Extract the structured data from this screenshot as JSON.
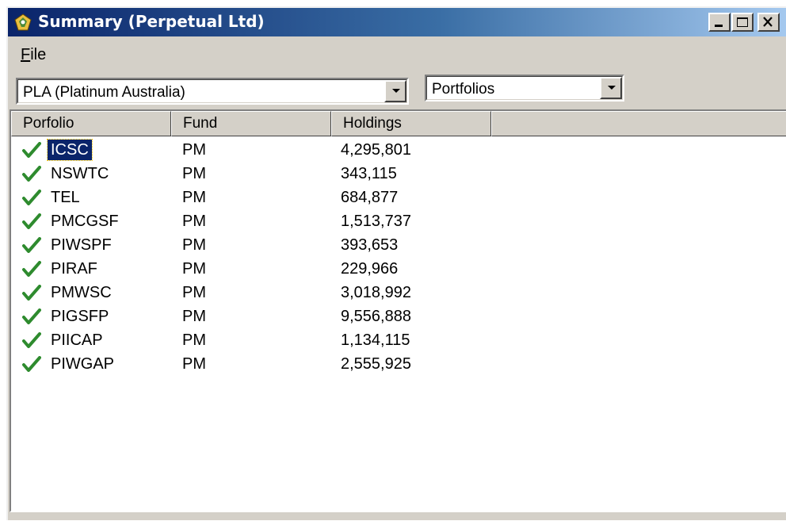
{
  "window": {
    "title": "Summary (Perpetual Ltd)",
    "icon": "app-icon",
    "controls": [
      "minimize-icon",
      "maximize-icon",
      "close-icon"
    ]
  },
  "menu": {
    "file_label_first": "F",
    "file_label_rest": "ile"
  },
  "filters": {
    "company": "PLA (Platinum Australia)",
    "view": "Portfolios"
  },
  "table": {
    "headers": [
      "Porfolio",
      "Fund",
      "Holdings",
      ""
    ],
    "rows": [
      {
        "portfolio": "ICSC",
        "fund": "PM",
        "holdings": "4,295,801",
        "status": "check-icon",
        "selected": true
      },
      {
        "portfolio": "NSWTC",
        "fund": "PM",
        "holdings": "343,115",
        "status": "check-icon"
      },
      {
        "portfolio": "TEL",
        "fund": "PM",
        "holdings": "684,877",
        "status": "check-icon"
      },
      {
        "portfolio": "PMCGSF",
        "fund": "PM",
        "holdings": "1,513,737",
        "status": "check-icon"
      },
      {
        "portfolio": "PIWSPF",
        "fund": "PM",
        "holdings": "393,653",
        "status": "check-icon"
      },
      {
        "portfolio": "PIRAF",
        "fund": "PM",
        "holdings": "229,966",
        "status": "check-icon"
      },
      {
        "portfolio": "PMWSC",
        "fund": "PM",
        "holdings": "3,018,992",
        "status": "check-icon"
      },
      {
        "portfolio": "PIGSFP",
        "fund": "PM",
        "holdings": "9,556,888",
        "status": "check-icon"
      },
      {
        "portfolio": "PIICAP",
        "fund": "PM",
        "holdings": "1,134,115",
        "status": "check-icon"
      },
      {
        "portfolio": "PIWGAP",
        "fund": "PM",
        "holdings": "2,555,925",
        "status": "check-icon"
      }
    ]
  },
  "colors": {
    "title_start": "#0a246a",
    "title_end": "#a6caf0",
    "check": "#2e8b2e",
    "selection": "#0a246a"
  }
}
